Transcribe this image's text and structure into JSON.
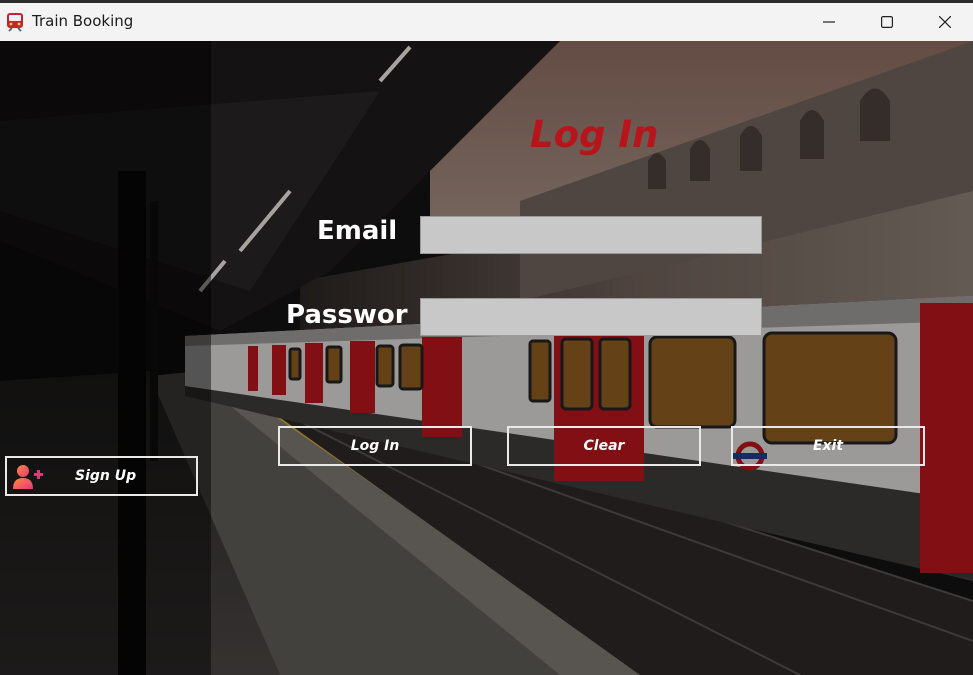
{
  "window": {
    "title": "Train Booking",
    "icon": "train-icon",
    "controls": [
      "minimize-icon",
      "maximize-icon",
      "close-icon"
    ]
  },
  "form": {
    "title": "Log In",
    "email_label": "Email",
    "email_value": "",
    "password_label": "Passwor",
    "password_value": ""
  },
  "buttons": {
    "login": "Log In",
    "clear": "Clear",
    "exit": "Exit",
    "signup": "Sign Up",
    "signup_icon": "add-user-icon"
  },
  "colors": {
    "title_red": "#b8141c",
    "input_bg": "#c8c8c8",
    "button_border": "#e9e9e9"
  }
}
